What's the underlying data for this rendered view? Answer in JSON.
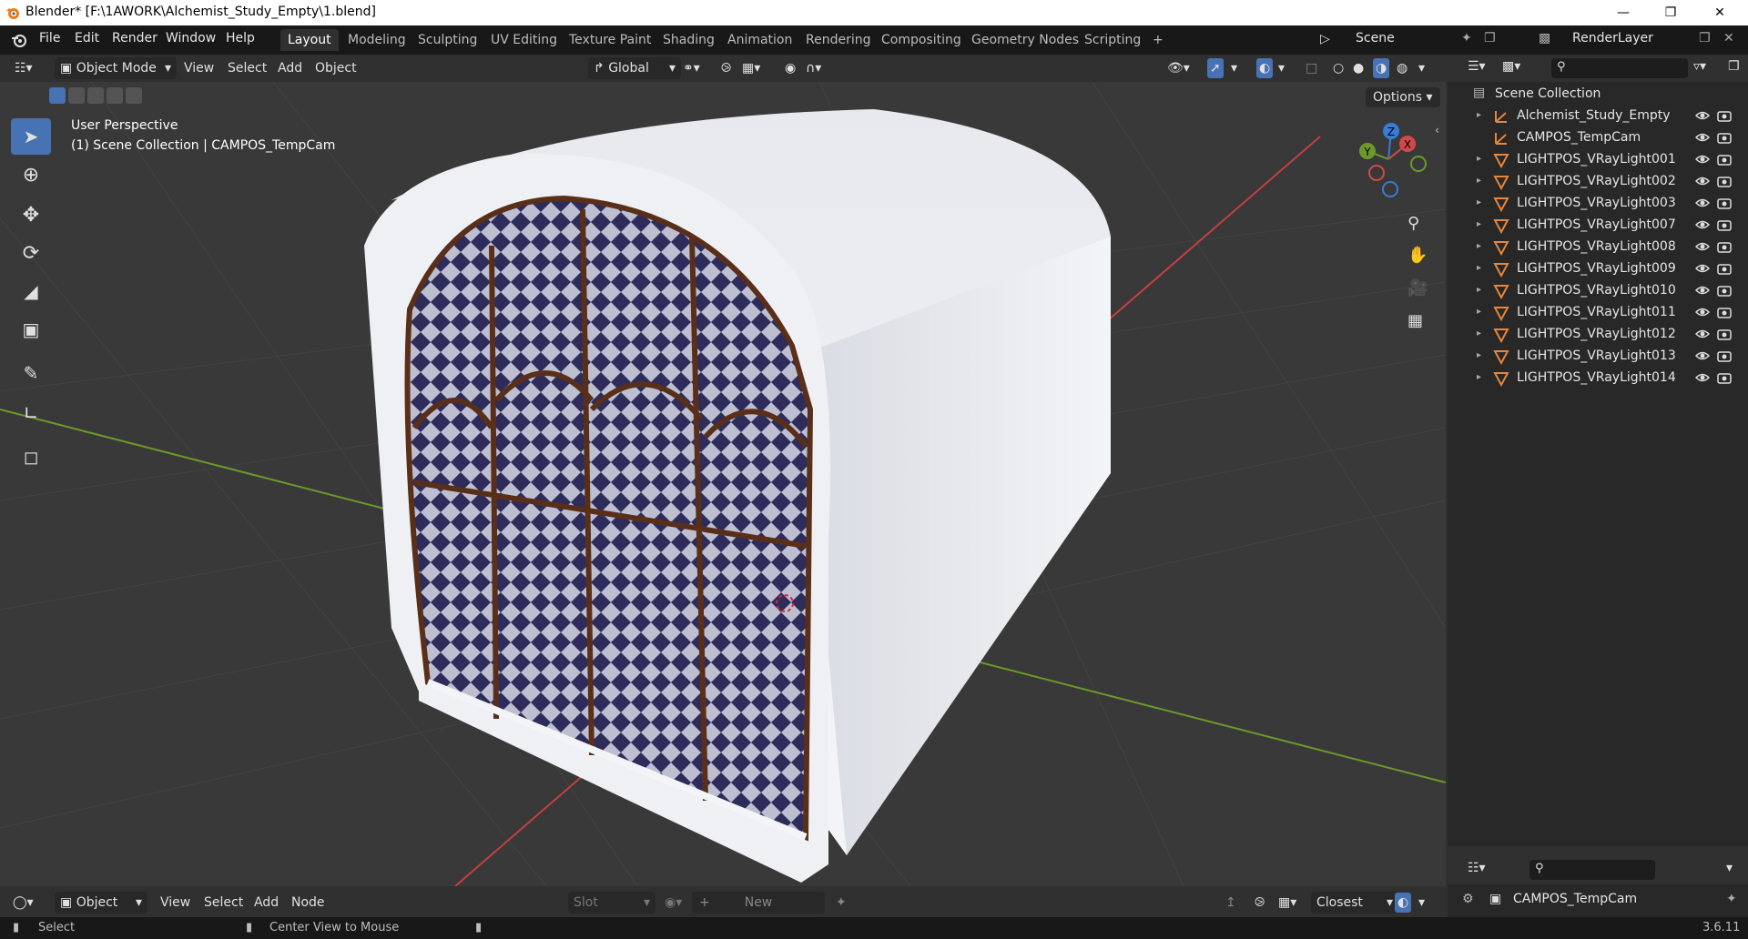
{
  "window": {
    "title": "Blender* [F:\\1AWORK\\Alchemist_Study_Empty\\1.blend]",
    "minimize_icon": "minimize-icon",
    "maximize_icon": "restore-icon",
    "close_icon": "close-icon"
  },
  "menu": {
    "items": [
      "File",
      "Edit",
      "Render",
      "Window",
      "Help"
    ]
  },
  "workspaces": {
    "tabs": [
      "Layout",
      "Modeling",
      "Sculpting",
      "UV Editing",
      "Texture Paint",
      "Shading",
      "Animation",
      "Rendering",
      "Compositing",
      "Geometry Nodes",
      "Scripting"
    ],
    "active": "Layout",
    "add_label": "+"
  },
  "scene": {
    "name": "Scene"
  },
  "viewlayer": {
    "name": "RenderLayer"
  },
  "viewport_header": {
    "mode": "Object Mode",
    "menus": [
      "View",
      "Select",
      "Add",
      "Object"
    ],
    "orientation": "Global",
    "options_label": "Options"
  },
  "viewport": {
    "perspective_label": "User Perspective",
    "context_label": "(1) Scene Collection | CAMPOS_TempCam",
    "gizmo": {
      "z": "Z",
      "y": "Y",
      "x": "X"
    },
    "colors": {
      "grid_bg": "#393939",
      "x_axis": "#c44040",
      "y_axis": "#6b9a2a",
      "active_tool": "#4772b3"
    }
  },
  "outliner": {
    "root": "Scene Collection",
    "items": [
      {
        "name": "Alchemist_Study_Empty",
        "type": "empty",
        "expandable": true
      },
      {
        "name": "CAMPOS_TempCam",
        "type": "empty",
        "expandable": false
      },
      {
        "name": "LIGHTPOS_VRayLight001",
        "type": "mesh",
        "expandable": true
      },
      {
        "name": "LIGHTPOS_VRayLight002",
        "type": "mesh",
        "expandable": true
      },
      {
        "name": "LIGHTPOS_VRayLight003",
        "type": "mesh",
        "expandable": true
      },
      {
        "name": "LIGHTPOS_VRayLight007",
        "type": "mesh",
        "expandable": true
      },
      {
        "name": "LIGHTPOS_VRayLight008",
        "type": "mesh",
        "expandable": true
      },
      {
        "name": "LIGHTPOS_VRayLight009",
        "type": "mesh",
        "expandable": true
      },
      {
        "name": "LIGHTPOS_VRayLight010",
        "type": "mesh",
        "expandable": true
      },
      {
        "name": "LIGHTPOS_VRayLight011",
        "type": "mesh",
        "expandable": true
      },
      {
        "name": "LIGHTPOS_VRayLight012",
        "type": "mesh",
        "expandable": true
      },
      {
        "name": "LIGHTPOS_VRayLight013",
        "type": "mesh",
        "expandable": true
      },
      {
        "name": "LIGHTPOS_VRayLight014",
        "type": "mesh",
        "expandable": true
      }
    ]
  },
  "properties": {
    "active_object": "CAMPOS_TempCam"
  },
  "node_header": {
    "object_label": "Object",
    "menus": [
      "View",
      "Select",
      "Add",
      "Node"
    ],
    "slot_label": "Slot",
    "new_label": "New",
    "snap_label": "Closest"
  },
  "statusbar": {
    "left_action": "Select",
    "middle_action": "Center View to Mouse",
    "version": "3.6.11"
  }
}
